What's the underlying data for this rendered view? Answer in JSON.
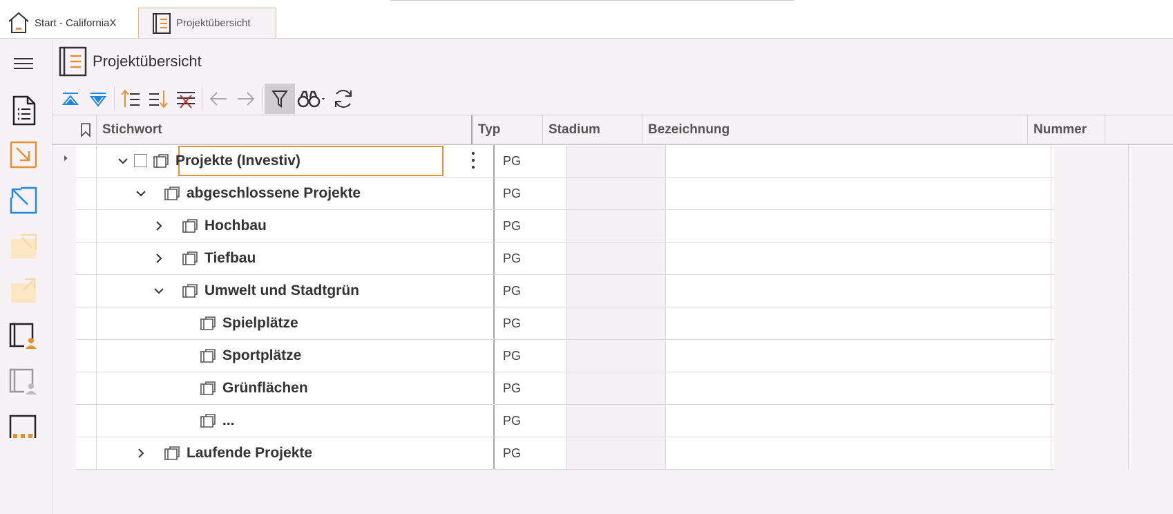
{
  "tabs": [
    {
      "label": "Start - CaliforniaX",
      "icon": "home-icon",
      "active": false
    },
    {
      "label": "Projektübersicht",
      "icon": "project-book-icon",
      "active": true
    }
  ],
  "sidebar": {
    "items": [
      {
        "icon": "hamburger-menu-icon"
      },
      {
        "icon": "document-list-icon"
      },
      {
        "icon": "import-arrow-icon"
      },
      {
        "icon": "export-arrow-icon"
      },
      {
        "icon": "import-folder-disabled-icon"
      },
      {
        "icon": "export-folder-disabled-icon"
      },
      {
        "icon": "project-user-icon"
      },
      {
        "icon": "project-user-disabled-icon"
      },
      {
        "icon": "folder-more-icon"
      }
    ]
  },
  "header": {
    "title": "Projektübersicht"
  },
  "toolbar": {
    "buttons": [
      "collapse-all-icon",
      "expand-all-icon",
      "sort-ascending-icon",
      "sort-descending-icon",
      "remove-sort-icon",
      "back-arrow-icon",
      "forward-arrow-icon",
      "filter-icon",
      "binoculars-search-icon",
      "refresh-icon"
    ]
  },
  "grid": {
    "columns": {
      "stichwort": "Stichwort",
      "typ": "Typ",
      "stadium": "Stadium",
      "bezeichnung": "Bezeichnung",
      "nummer": "Nummer"
    },
    "rows": [
      {
        "label": "Projekte (Investiv)",
        "typ": "PG",
        "level": 0,
        "chevron": "down",
        "checkbox": true,
        "selected": true
      },
      {
        "label": "abgeschlossene Projekte",
        "typ": "PG",
        "level": 1,
        "chevron": "down"
      },
      {
        "label": "Hochbau",
        "typ": "PG",
        "level": 2,
        "chevron": "right"
      },
      {
        "label": "Tiefbau",
        "typ": "PG",
        "level": 2,
        "chevron": "right"
      },
      {
        "label": "Umwelt und Stadtgrün",
        "typ": "PG",
        "level": 2,
        "chevron": "down"
      },
      {
        "label": "Spielplätze",
        "typ": "PG",
        "level": 3,
        "chevron": ""
      },
      {
        "label": "Sportplätze",
        "typ": "PG",
        "level": 3,
        "chevron": ""
      },
      {
        "label": "Grünflächen",
        "typ": "PG",
        "level": 3,
        "chevron": ""
      },
      {
        "label": "...",
        "typ": "PG",
        "level": 3,
        "chevron": ""
      },
      {
        "label": "Laufende Projekte",
        "typ": "PG",
        "level": 1,
        "chevron": "right"
      }
    ]
  },
  "colors": {
    "accent": "#e89030",
    "blue": "#1e88e5",
    "background": "#f6f2f6"
  }
}
